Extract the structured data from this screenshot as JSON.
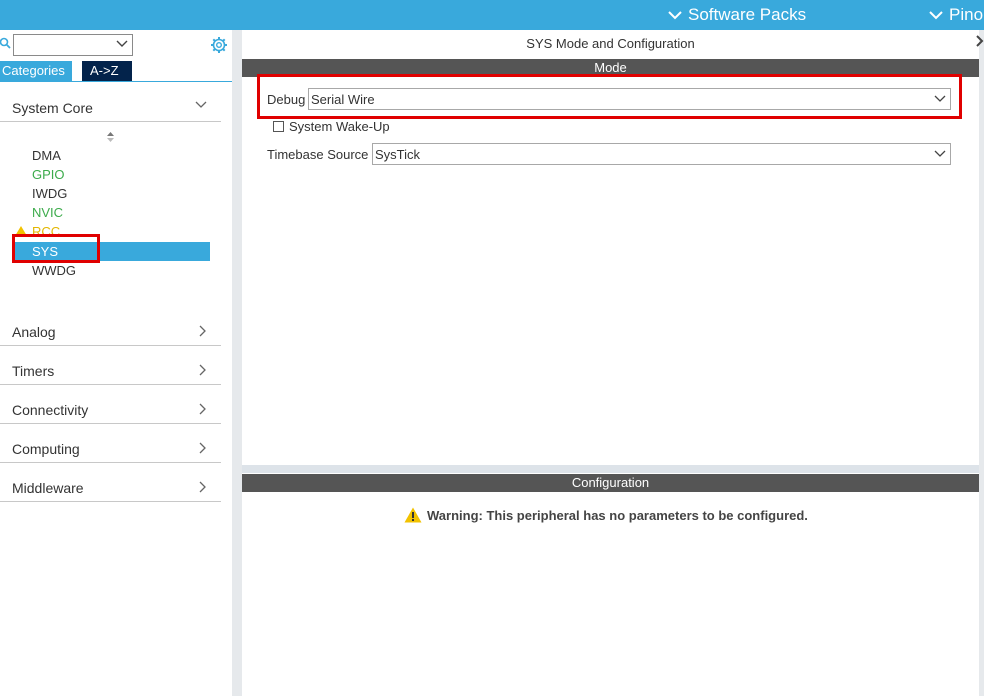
{
  "topbar": {
    "software_packs": "Software Packs",
    "pinout": "Pino"
  },
  "sidebar": {
    "search": {
      "value": ""
    },
    "tabs": {
      "categories": "Categories",
      "az": "A->Z"
    },
    "system_core": {
      "label": "System Core",
      "items": [
        {
          "label": "DMA",
          "status": "dark"
        },
        {
          "label": "GPIO",
          "status": "green"
        },
        {
          "label": "IWDG",
          "status": "dark"
        },
        {
          "label": "NVIC",
          "status": "green"
        },
        {
          "label": "RCC",
          "status": "warning"
        },
        {
          "label": "SYS",
          "status": "selected"
        },
        {
          "label": "WWDG",
          "status": "dark"
        }
      ]
    },
    "groups": [
      "Analog",
      "Timers",
      "Connectivity",
      "Computing",
      "Middleware"
    ]
  },
  "main": {
    "title": "SYS Mode and Configuration",
    "mode_header": "Mode",
    "debug": {
      "label": "Debug",
      "value": "Serial Wire"
    },
    "wakeup": {
      "label": "System Wake-Up",
      "checked": false
    },
    "timebase": {
      "label": "Timebase Source",
      "value": "SysTick"
    },
    "config_header": "Configuration",
    "warning": "Warning: This peripheral has no parameters to be configured."
  },
  "colors": {
    "accent": "#39a9dc",
    "dark_tab": "#03234b",
    "enabled": "#3cab4b",
    "warning": "#e3b600",
    "highlight": "#e00000"
  }
}
